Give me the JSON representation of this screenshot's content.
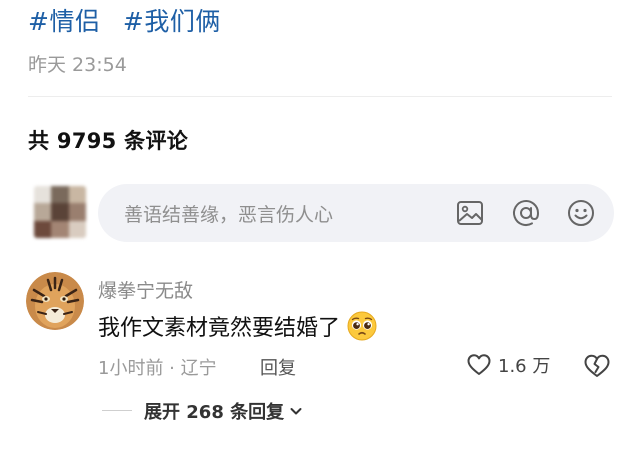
{
  "post": {
    "hashtags": [
      "#情侣",
      "#我们俩"
    ],
    "time": "昨天 23:54"
  },
  "comments_header": {
    "count_text": "共 9795 条评论"
  },
  "comment_input": {
    "placeholder": "善语结善缘，恶言伤人心",
    "icons": [
      "image-icon",
      "at-icon",
      "emoji-icon"
    ]
  },
  "comments": [
    {
      "username": "爆拳宁无敌",
      "text": "我作文素材竟然要结婚了",
      "emoji": "pleading-face-emoji",
      "time_location": "1小时前 · 辽宁",
      "reply_label": "回复",
      "likes": "1.6 万",
      "expand_label": "展开 268 条回复"
    }
  ],
  "colors": {
    "hashtag": "#1e5fa6",
    "muted_text": "#9a9a9a",
    "input_bg": "#f1f2f6"
  }
}
